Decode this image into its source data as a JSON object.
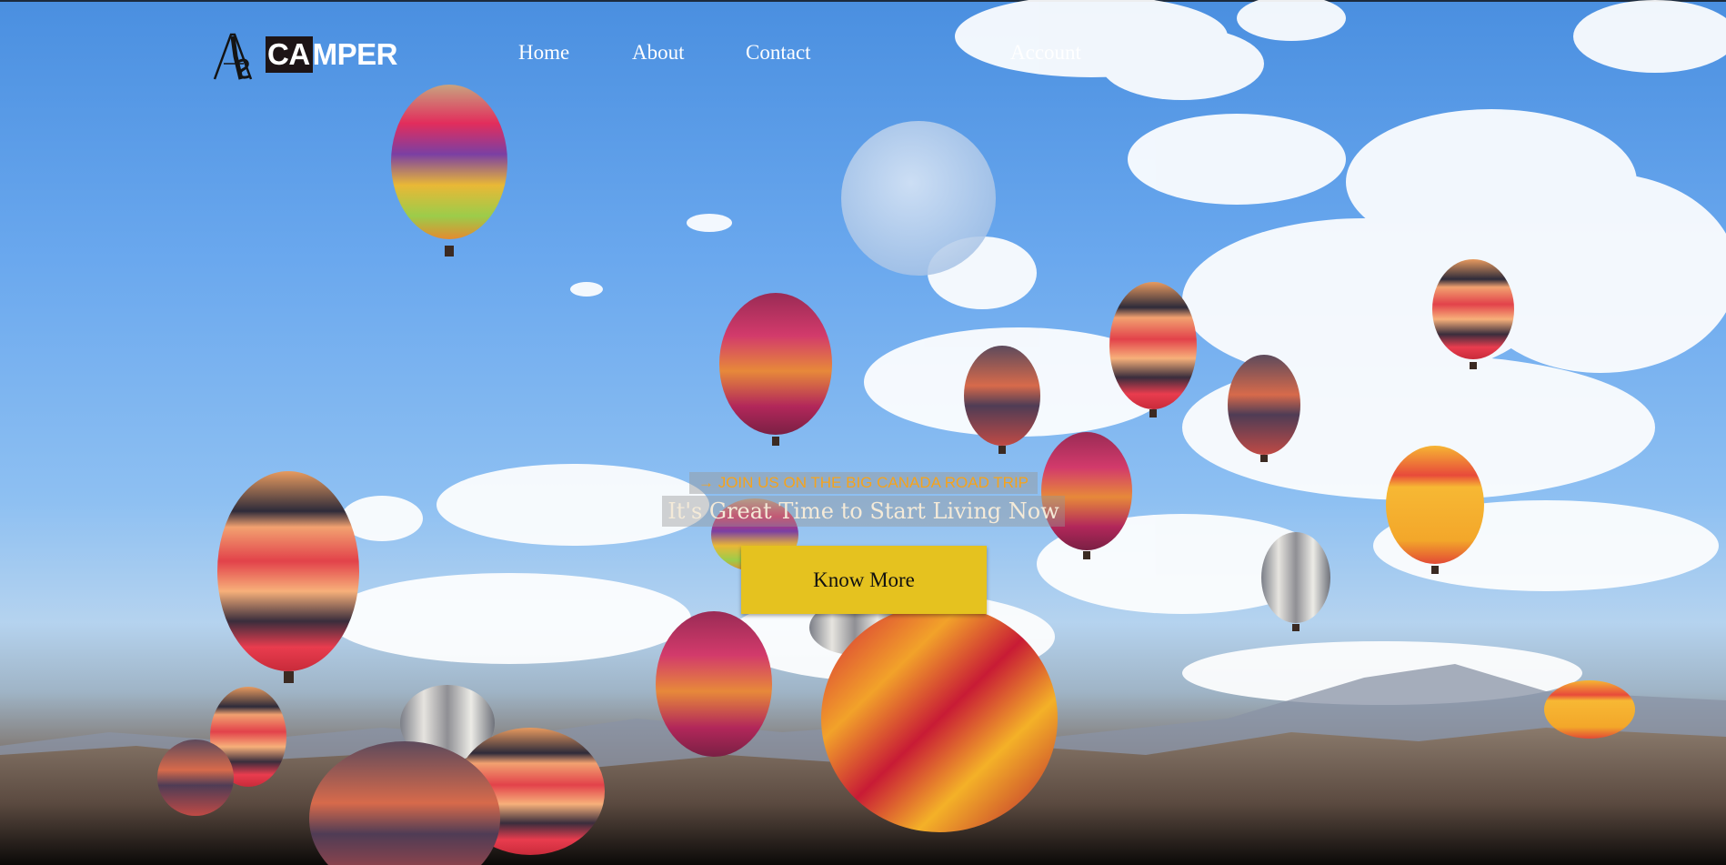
{
  "brand": {
    "mark_letters": "AS",
    "name_highlight": "CA",
    "name_rest": "MPER"
  },
  "nav": {
    "home": "Home",
    "about": "About",
    "contact": "Contact",
    "account": "Account"
  },
  "hero": {
    "kicker": "→ JOIN US ON THE BIG CANADA ROAD TRIP",
    "headline": "It's Great Time to Start Living Now",
    "cta_label": "Know More"
  },
  "colors": {
    "kicker_text": "#f6a31b",
    "cta_background": "#e5c21f",
    "nav_text": "#ffffff"
  }
}
